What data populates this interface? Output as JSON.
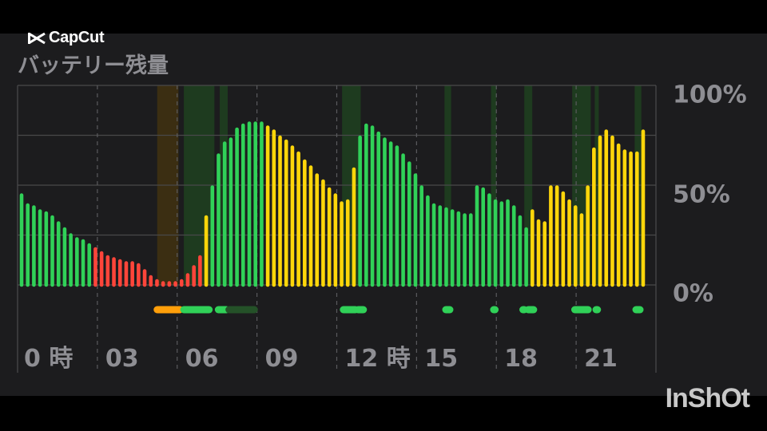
{
  "brand": {
    "label": "CapCut",
    "icon": "capcut-logo-icon"
  },
  "title": "バッテリー残量",
  "watermark": "InShOt",
  "chart_data": {
    "type": "bar",
    "ylabel_ticks": [
      "100%",
      "50%",
      "0%"
    ],
    "ylim": [
      0,
      100
    ],
    "grid": true,
    "x_tick_labels": [
      "0 時",
      "03",
      "06",
      "09",
      "12 時",
      "15",
      "18",
      "21"
    ],
    "x_tick_hours": [
      0,
      3,
      6,
      9,
      12,
      15,
      18,
      21
    ],
    "hours_span": [
      0,
      24
    ],
    "colors": {
      "discharging_ok": "#30d158",
      "low": "#ff453a",
      "charging": "#ffd60a",
      "charge_band": "#1e3b1f",
      "orange_band": "#3b2e12",
      "orange_pill": "#ff9f0a",
      "dark_pill": "#245128"
    },
    "series": [
      {
        "values": [
          45,
          40,
          39,
          37,
          36,
          34,
          31,
          28,
          25,
          23,
          22,
          20
        ],
        "color": "green"
      },
      {
        "values": [
          18,
          16,
          14,
          13,
          12,
          11,
          11,
          10,
          7,
          4,
          2,
          1,
          1,
          1,
          2,
          5,
          9,
          14
        ],
        "color": "red"
      },
      {
        "values": [
          34
        ],
        "color": "yellow"
      },
      {
        "values": [
          49,
          65,
          71,
          73,
          78,
          80,
          81,
          81,
          81
        ],
        "color": "green"
      },
      {
        "values": [
          79,
          77,
          74,
          72,
          69,
          66,
          62,
          59,
          55,
          52,
          48,
          45,
          41,
          42,
          58
        ],
        "color": "yellow"
      },
      {
        "values": [
          74,
          80,
          79,
          76,
          73,
          71,
          69,
          65,
          61,
          55,
          49,
          44,
          40,
          39,
          38,
          37,
          36,
          35,
          35
        ],
        "color": "green"
      },
      {
        "values": [
          49,
          48,
          45,
          42,
          41,
          42,
          39,
          34,
          28
        ],
        "color": "green"
      },
      {
        "values": [
          37,
          32,
          31,
          49,
          49,
          46,
          42,
          39,
          35,
          49,
          68,
          74,
          77,
          74,
          70,
          67,
          66,
          66,
          77
        ],
        "color": "yellow"
      }
    ],
    "charge_bands_hours": [
      [
        6.25,
        7.4
      ],
      [
        7.6,
        7.9
      ],
      [
        12.2,
        12.9
      ],
      [
        16.05,
        16.3
      ],
      [
        17.8,
        18.0
      ],
      [
        19.05,
        19.35
      ],
      [
        20.85,
        21.55
      ],
      [
        21.7,
        21.85
      ],
      [
        23.2,
        23.45
      ]
    ],
    "orange_band_hours": [
      [
        5.25,
        6.05
      ]
    ],
    "pills": [
      {
        "from": 5.25,
        "to": 6.1,
        "color": "orange"
      },
      {
        "from": 6.25,
        "to": 7.2,
        "color": "green"
      },
      {
        "from": 7.55,
        "to": 7.85,
        "color": "green"
      },
      {
        "from": 7.95,
        "to": 8.9,
        "color": "dark"
      },
      {
        "from": 12.25,
        "to": 12.7,
        "color": "green"
      },
      {
        "from": 12.8,
        "to": 13.0,
        "color": "green"
      },
      {
        "from": 16.1,
        "to": 16.25,
        "color": "green"
      },
      {
        "from": 17.9,
        "to": 17.95,
        "color": "green"
      },
      {
        "from": 19.0,
        "to": 19.05,
        "color": "green"
      },
      {
        "from": 19.2,
        "to": 19.4,
        "color": "green"
      },
      {
        "from": 20.95,
        "to": 21.45,
        "color": "green"
      },
      {
        "from": 21.75,
        "to": 21.8,
        "color": "green"
      },
      {
        "from": 23.25,
        "to": 23.4,
        "color": "green"
      }
    ]
  }
}
